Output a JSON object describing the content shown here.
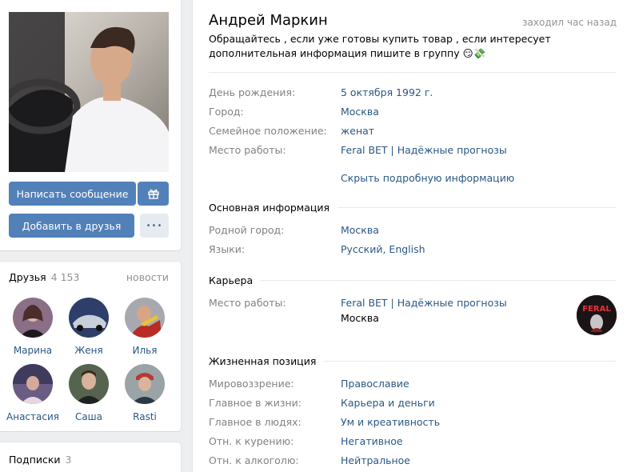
{
  "profile": {
    "name": "Андрей Маркин",
    "online": "заходил час назад",
    "status": "Обращайтесь , если уже готовы купить товар , если интересует дополнительная информация пишите в группу 😏💸"
  },
  "actions": {
    "message": "Написать сообщение",
    "add_friend": "Добавить в друзья",
    "more": "•••"
  },
  "friends": {
    "title": "Друзья",
    "count": "4 153",
    "updates": "новости",
    "items": [
      {
        "name": "Марина"
      },
      {
        "name": "Женя"
      },
      {
        "name": "Илья"
      },
      {
        "name": "Анастасия"
      },
      {
        "name": "Саша"
      },
      {
        "name": "Rasti"
      }
    ]
  },
  "subscriptions": {
    "title": "Подписки",
    "count": "3"
  },
  "short_info": [
    {
      "label": "День рождения:",
      "value": "5 октября 1992 г."
    },
    {
      "label": "Город:",
      "value": "Москва"
    },
    {
      "label": "Семейное положение:",
      "value": "женат"
    },
    {
      "label": "Место работы:",
      "value": "Feral BET | Надёжные прогнозы"
    }
  ],
  "hide_details": "Скрыть подробную информацию",
  "main_info": {
    "title": "Основная информация",
    "rows": [
      {
        "label": "Родной город:",
        "value": "Москва"
      },
      {
        "label": "Языки:",
        "value": "Русский, English"
      }
    ]
  },
  "career": {
    "title": "Карьера",
    "label": "Место работы:",
    "company": "Feral BET | Надёжные прогнозы",
    "city": "Москва",
    "logo_text": "FERAL"
  },
  "life_position": {
    "title": "Жизненная позиция",
    "rows": [
      {
        "label": "Мировоззрение:",
        "value": "Православие"
      },
      {
        "label": "Главное в жизни:",
        "value": "Карьера и деньги"
      },
      {
        "label": "Главное в людях:",
        "value": "Ум и креативность"
      },
      {
        "label": "Отн. к курению:",
        "value": "Негативное"
      },
      {
        "label": "Отн. к алкоголю:",
        "value": "Нейтральное"
      }
    ]
  },
  "colors": {
    "accent": "#5181b8",
    "link": "#2a5885",
    "muted": "#828282"
  }
}
